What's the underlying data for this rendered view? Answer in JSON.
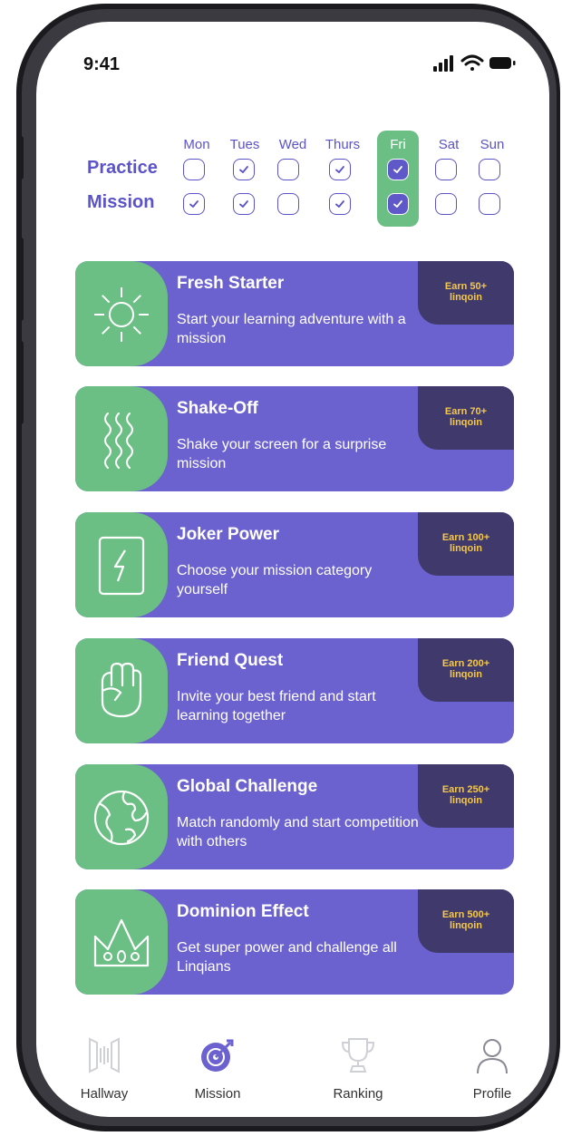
{
  "status_bar": {
    "time": "9:41"
  },
  "tracker": {
    "days": [
      "Mon",
      "Tues",
      "Wed",
      "Thurs",
      "Fri",
      "Sat",
      "Sun"
    ],
    "highlighted_day": "Fri",
    "practice_label": "Practice",
    "mission_label": "Mission",
    "practice_checked": [
      false,
      true,
      false,
      true,
      true,
      false,
      false
    ],
    "mission_checked": [
      true,
      true,
      false,
      true,
      true,
      false,
      false
    ]
  },
  "missions": [
    {
      "title": "Fresh Starter",
      "description": "Start your learning adventure with a mission",
      "reward": "Earn 50+\nlinqoin",
      "icon": "sun-icon"
    },
    {
      "title": "Shake-Off",
      "description": "Shake your screen for a surprise mission",
      "reward": "Earn 70+\nlinqoin",
      "icon": "shake-waves-icon"
    },
    {
      "title": "Joker Power",
      "description": "Choose your mission category yourself",
      "reward": "Earn 100+\nlinqoin",
      "icon": "lightning-card-icon"
    },
    {
      "title": "Friend Quest",
      "description": "Invite your best friend and start learning together",
      "reward": "Earn 200+\nlinqoin",
      "icon": "fist-icon"
    },
    {
      "title": "Global Challenge",
      "description": "Match randomly and start competition with others",
      "reward": "Earn 250+\nlinqoin",
      "icon": "globe-icon"
    },
    {
      "title": "Dominion Effect",
      "description": "Get super power and challenge all Linqians",
      "reward": "Earn 500+\nlinqoin",
      "icon": "crown-icon"
    }
  ],
  "tab_bar": {
    "tabs": [
      {
        "label": "Hallway",
        "icon": "hallway-icon",
        "active": false
      },
      {
        "label": "Mission",
        "icon": "target-icon",
        "active": true
      },
      {
        "label": "Ranking",
        "icon": "trophy-icon",
        "active": false
      },
      {
        "label": "Profile",
        "icon": "person-icon",
        "active": false
      }
    ]
  },
  "colors": {
    "purple": "#6b62cf",
    "green": "#6cbf84",
    "dark": "#3f3a6b",
    "gold": "#f5c84b"
  }
}
